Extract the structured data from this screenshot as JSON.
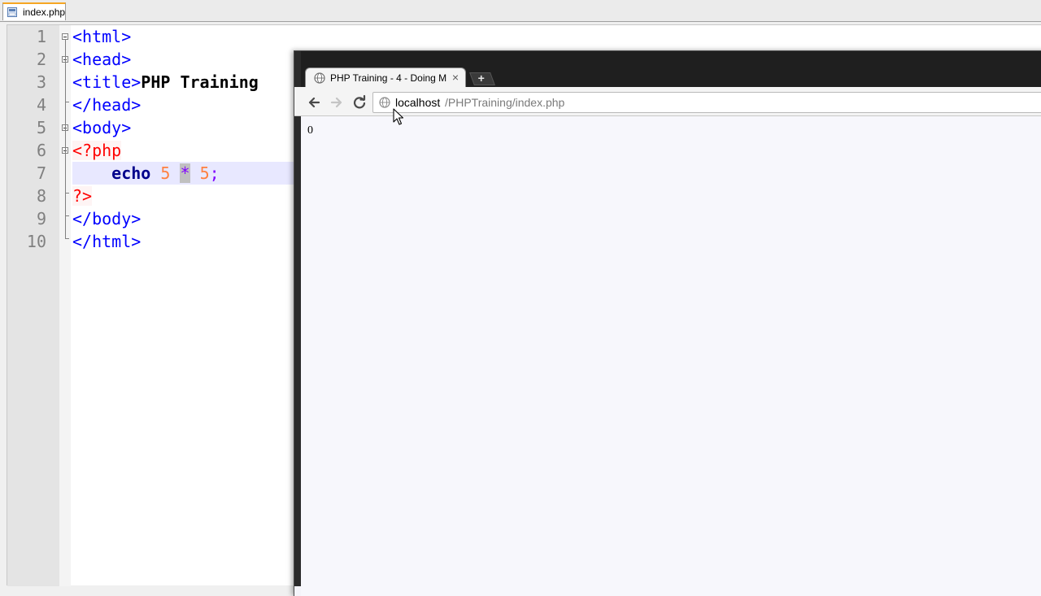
{
  "editor": {
    "tab_label": "index.php",
    "lines": [
      "1",
      "2",
      "3",
      "4",
      "5",
      "6",
      "7",
      "8",
      "9",
      "10"
    ],
    "code": {
      "l1": "<html>",
      "l2": "<head>",
      "l3_open": "<title>",
      "l3_text": "PHP Training",
      "l4": "</head>",
      "l5": "<body>",
      "l6": "<?php",
      "l7_echo": "echo",
      "l7_num1": "5",
      "l7_op": "*",
      "l7_num2": "5",
      "l7_semi": ";",
      "l8": "?>",
      "l9": "</body>",
      "l10": "</html>"
    }
  },
  "browser": {
    "tab_title": "PHP Training - 4 - Doing M",
    "close_glyph": "×",
    "newtab_glyph": "+",
    "url_host": "localhost",
    "url_path": "/PHPTraining/index.php",
    "page_output": "0"
  },
  "colors": {
    "tag": "#0000ff",
    "php_tag": "#ff0000",
    "keyword": "#00008b",
    "number": "#ff8040",
    "operator": "#8000ff",
    "current_line": "#e8e8ff"
  }
}
